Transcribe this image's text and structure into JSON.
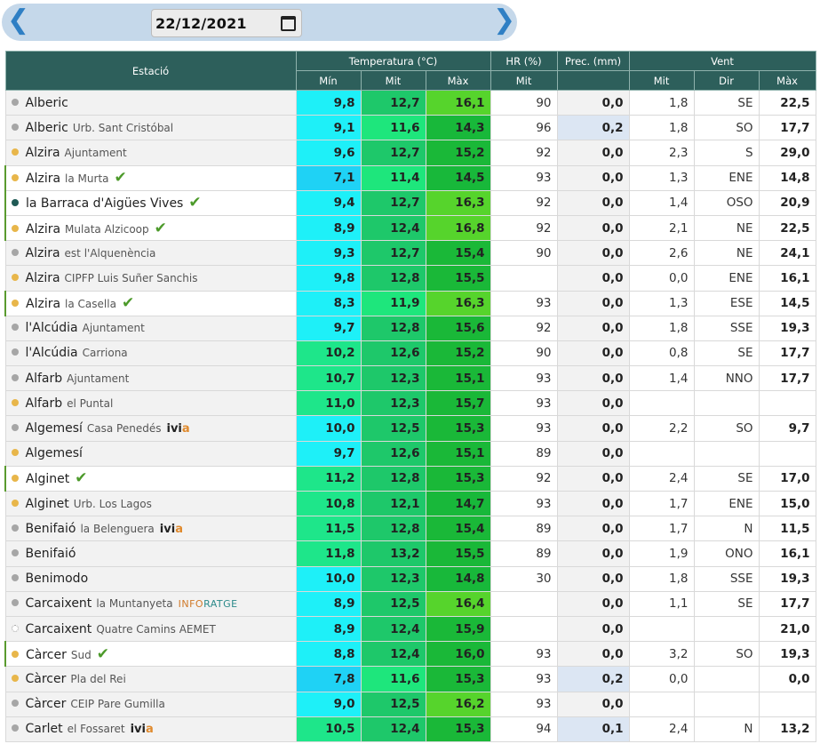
{
  "date_nav": {
    "prev_icon": "chevron-left-icon",
    "next_icon": "chevron-right-icon",
    "date_value": "22/12/2021",
    "calendar_icon": "calendar-icon"
  },
  "headers": {
    "station": "Estació",
    "temperature": "Temperatura (°C)",
    "hr": "HR (%)",
    "prec": "Prec. (mm)",
    "wind": "Vent",
    "t_min": "Mín",
    "t_mit": "Mit",
    "t_max": "Màx",
    "hr_mit": "Mit",
    "w_mit": "Mit",
    "w_dir": "Dir",
    "w_max": "Màx"
  },
  "colors": {
    "header_bg": "#2d5f5b",
    "dot_gray": "#a6a6a6",
    "dot_orange": "#e8b64a",
    "dot_teal": "#1f5a55",
    "check": "#4c9a2a",
    "prec_highlight": "#dce6f3"
  },
  "rows": [
    {
      "name": "Alberic",
      "loc": "",
      "dot": "gray",
      "hl": false,
      "check": false,
      "badge": "",
      "tmin": "9,8",
      "tmit": "12,7",
      "tmax": "16,1",
      "hr": "90",
      "prec": "0,0",
      "wmit": "1,8",
      "wdir": "SE",
      "wmax": "22,5",
      "cmin": "#1ef0f8",
      "cmit": "#1ec86a",
      "cmax": "#56d42c"
    },
    {
      "name": "Alberic",
      "loc": "Urb. Sant Cristóbal",
      "dot": "gray",
      "hl": false,
      "check": false,
      "badge": "",
      "tmin": "9,1",
      "tmit": "11,6",
      "tmax": "14,3",
      "hr": "96",
      "prec": "0,2",
      "wmit": "1,8",
      "wdir": "SO",
      "wmax": "17,7",
      "cmin": "#1ef0f8",
      "cmit": "#1ee67c",
      "cmax": "#18b83a"
    },
    {
      "name": "Alzira",
      "loc": "Ajuntament",
      "dot": "orange",
      "hl": false,
      "check": false,
      "badge": "",
      "tmin": "9,6",
      "tmit": "12,7",
      "tmax": "15,2",
      "hr": "92",
      "prec": "0,0",
      "wmit": "2,3",
      "wdir": "S",
      "wmax": "29,0",
      "cmin": "#1ef0f8",
      "cmit": "#1ec86a",
      "cmax": "#1ab838"
    },
    {
      "name": "Alzira",
      "loc": "la Murta",
      "dot": "orange",
      "hl": true,
      "check": true,
      "badge": "",
      "tmin": "7,1",
      "tmit": "11,4",
      "tmax": "14,5",
      "hr": "93",
      "prec": "0,0",
      "wmit": "1,3",
      "wdir": "ENE",
      "wmax": "14,8",
      "cmin": "#1fd2f5",
      "cmit": "#1ee67c",
      "cmax": "#18b83a"
    },
    {
      "name": "la Barraca d'Aigües Vives",
      "loc": "",
      "dot": "teal",
      "hl": true,
      "check": true,
      "badge": "",
      "tmin": "9,4",
      "tmit": "12,7",
      "tmax": "16,3",
      "hr": "92",
      "prec": "0,0",
      "wmit": "1,4",
      "wdir": "OSO",
      "wmax": "20,9",
      "cmin": "#1ef0f8",
      "cmit": "#1ec86a",
      "cmax": "#56d42c"
    },
    {
      "name": "Alzira",
      "loc": "Mulata Alzicoop",
      "dot": "orange",
      "hl": true,
      "check": true,
      "badge": "",
      "tmin": "8,9",
      "tmit": "12,4",
      "tmax": "16,8",
      "hr": "92",
      "prec": "0,0",
      "wmit": "2,1",
      "wdir": "NE",
      "wmax": "22,5",
      "cmin": "#1ef0f8",
      "cmit": "#1ec86a",
      "cmax": "#56d42c"
    },
    {
      "name": "Alzira",
      "loc": "est l'Alquenència",
      "dot": "gray",
      "hl": false,
      "check": false,
      "badge": "",
      "tmin": "9,3",
      "tmit": "12,7",
      "tmax": "15,4",
      "hr": "90",
      "prec": "0,0",
      "wmit": "2,6",
      "wdir": "NE",
      "wmax": "24,1",
      "cmin": "#1ef0f8",
      "cmit": "#1ec86a",
      "cmax": "#1ab838"
    },
    {
      "name": "Alzira",
      "loc": "CIPFP Luis Suñer Sanchis",
      "dot": "orange",
      "hl": false,
      "check": false,
      "badge": "",
      "tmin": "9,8",
      "tmit": "12,8",
      "tmax": "15,5",
      "hr": "",
      "prec": "0,0",
      "wmit": "0,0",
      "wdir": "ENE",
      "wmax": "16,1",
      "cmin": "#1ef0f8",
      "cmit": "#1ec86a",
      "cmax": "#1ab838"
    },
    {
      "name": "Alzira",
      "loc": "la Casella",
      "dot": "orange",
      "hl": true,
      "check": true,
      "badge": "",
      "tmin": "8,3",
      "tmit": "11,9",
      "tmax": "16,3",
      "hr": "93",
      "prec": "0,0",
      "wmit": "1,3",
      "wdir": "ESE",
      "wmax": "14,5",
      "cmin": "#1ef0f8",
      "cmit": "#1ee67c",
      "cmax": "#56d42c"
    },
    {
      "name": "l'Alcúdia",
      "loc": "Ajuntament",
      "dot": "gray",
      "hl": false,
      "check": false,
      "badge": "",
      "tmin": "9,7",
      "tmit": "12,8",
      "tmax": "15,6",
      "hr": "92",
      "prec": "0,0",
      "wmit": "1,8",
      "wdir": "SSE",
      "wmax": "19,3",
      "cmin": "#1ef0f8",
      "cmit": "#1ec86a",
      "cmax": "#1ab838"
    },
    {
      "name": "l'Alcúdia",
      "loc": "Carriona",
      "dot": "gray",
      "hl": false,
      "check": false,
      "badge": "",
      "tmin": "10,2",
      "tmit": "12,6",
      "tmax": "15,2",
      "hr": "90",
      "prec": "0,0",
      "wmit": "0,8",
      "wdir": "SE",
      "wmax": "17,7",
      "cmin": "#1ee68a",
      "cmit": "#1ec86a",
      "cmax": "#1ab838"
    },
    {
      "name": "Alfarb",
      "loc": "Ajuntament",
      "dot": "gray",
      "hl": false,
      "check": false,
      "badge": "",
      "tmin": "10,7",
      "tmit": "12,3",
      "tmax": "15,1",
      "hr": "93",
      "prec": "0,0",
      "wmit": "1,4",
      "wdir": "NNO",
      "wmax": "17,7",
      "cmin": "#1ee68a",
      "cmit": "#1ec86a",
      "cmax": "#1ab838"
    },
    {
      "name": "Alfarb",
      "loc": "el Puntal",
      "dot": "orange",
      "hl": false,
      "check": false,
      "badge": "",
      "tmin": "11,0",
      "tmit": "12,3",
      "tmax": "15,7",
      "hr": "93",
      "prec": "0,0",
      "wmit": "",
      "wdir": "",
      "wmax": "",
      "cmin": "#1ee68a",
      "cmit": "#1ec86a",
      "cmax": "#1ab838"
    },
    {
      "name": "Algemesí",
      "loc": "Casa Penedés",
      "dot": "gray",
      "hl": false,
      "check": false,
      "badge": "ivia",
      "tmin": "10,0",
      "tmit": "12,5",
      "tmax": "15,3",
      "hr": "93",
      "prec": "0,0",
      "wmit": "2,2",
      "wdir": "SO",
      "wmax": "9,7",
      "cmin": "#1ef0f8",
      "cmit": "#1ec86a",
      "cmax": "#1ab838"
    },
    {
      "name": "Algemesí",
      "loc": "",
      "dot": "orange",
      "hl": false,
      "check": false,
      "badge": "",
      "tmin": "9,7",
      "tmit": "12,6",
      "tmax": "15,1",
      "hr": "89",
      "prec": "0,0",
      "wmit": "",
      "wdir": "",
      "wmax": "",
      "cmin": "#1ef0f8",
      "cmit": "#1ec86a",
      "cmax": "#1ab838"
    },
    {
      "name": "Alginet",
      "loc": "",
      "dot": "orange",
      "hl": true,
      "check": true,
      "badge": "",
      "tmin": "11,2",
      "tmit": "12,8",
      "tmax": "15,3",
      "hr": "92",
      "prec": "0,0",
      "wmit": "2,4",
      "wdir": "SE",
      "wmax": "17,0",
      "cmin": "#1ee68a",
      "cmit": "#1ec86a",
      "cmax": "#1ab838"
    },
    {
      "name": "Alginet",
      "loc": "Urb. Los Lagos",
      "dot": "orange",
      "hl": false,
      "check": false,
      "badge": "",
      "tmin": "10,8",
      "tmit": "12,1",
      "tmax": "14,7",
      "hr": "93",
      "prec": "0,0",
      "wmit": "1,7",
      "wdir": "ENE",
      "wmax": "15,0",
      "cmin": "#1ee68a",
      "cmit": "#1ec86a",
      "cmax": "#18b83a"
    },
    {
      "name": "Benifaió",
      "loc": "la Belenguera",
      "dot": "gray",
      "hl": false,
      "check": false,
      "badge": "ivia",
      "tmin": "11,5",
      "tmit": "12,8",
      "tmax": "15,4",
      "hr": "89",
      "prec": "0,0",
      "wmit": "1,7",
      "wdir": "N",
      "wmax": "11,5",
      "cmin": "#1ee68a",
      "cmit": "#1ec86a",
      "cmax": "#1ab838"
    },
    {
      "name": "Benifaió",
      "loc": "",
      "dot": "gray",
      "hl": false,
      "check": false,
      "badge": "",
      "tmin": "11,8",
      "tmit": "13,2",
      "tmax": "15,5",
      "hr": "89",
      "prec": "0,0",
      "wmit": "1,9",
      "wdir": "ONO",
      "wmax": "16,1",
      "cmin": "#1ee68a",
      "cmit": "#1ec86a",
      "cmax": "#1ab838"
    },
    {
      "name": "Benimodo",
      "loc": "",
      "dot": "gray",
      "hl": false,
      "check": false,
      "badge": "",
      "tmin": "10,0",
      "tmit": "12,3",
      "tmax": "14,8",
      "hr": "30",
      "prec": "0,0",
      "wmit": "1,8",
      "wdir": "SSE",
      "wmax": "19,3",
      "cmin": "#1ef0f8",
      "cmit": "#1ec86a",
      "cmax": "#18b83a"
    },
    {
      "name": "Carcaixent",
      "loc": "la Muntanyeta",
      "dot": "gray",
      "hl": false,
      "check": false,
      "badge": "inforatge",
      "tmin": "8,9",
      "tmit": "12,5",
      "tmax": "16,4",
      "hr": "",
      "prec": "0,0",
      "wmit": "1,1",
      "wdir": "SE",
      "wmax": "17,7",
      "cmin": "#1ef0f8",
      "cmit": "#1ec86a",
      "cmax": "#56d42c"
    },
    {
      "name": "Carcaixent",
      "loc": "Quatre Camins AEMET",
      "dot": "empty",
      "hl": false,
      "check": false,
      "badge": "",
      "tmin": "8,9",
      "tmit": "12,4",
      "tmax": "15,9",
      "hr": "",
      "prec": "0,0",
      "wmit": "",
      "wdir": "",
      "wmax": "21,0",
      "cmin": "#1ef0f8",
      "cmit": "#1ec86a",
      "cmax": "#1ab838"
    },
    {
      "name": "Càrcer",
      "loc": "Sud",
      "dot": "orange",
      "hl": true,
      "check": true,
      "badge": "",
      "tmin": "8,8",
      "tmit": "12,4",
      "tmax": "16,0",
      "hr": "93",
      "prec": "0,0",
      "wmit": "3,2",
      "wdir": "SO",
      "wmax": "19,3",
      "cmin": "#1ef0f8",
      "cmit": "#1ec86a",
      "cmax": "#1ab838"
    },
    {
      "name": "Càrcer",
      "loc": "Pla del Rei",
      "dot": "orange",
      "hl": false,
      "check": false,
      "badge": "",
      "tmin": "7,8",
      "tmit": "11,6",
      "tmax": "15,3",
      "hr": "93",
      "prec": "0,2",
      "wmit": "0,0",
      "wdir": "",
      "wmax": "0,0",
      "cmin": "#1fd2f5",
      "cmit": "#1ee67c",
      "cmax": "#1ab838"
    },
    {
      "name": "Càrcer",
      "loc": "CEIP Pare Gumilla",
      "dot": "gray",
      "hl": false,
      "check": false,
      "badge": "",
      "tmin": "9,0",
      "tmit": "12,5",
      "tmax": "16,2",
      "hr": "93",
      "prec": "0,0",
      "wmit": "",
      "wdir": "",
      "wmax": "",
      "cmin": "#1ef0f8",
      "cmit": "#1ec86a",
      "cmax": "#56d42c"
    },
    {
      "name": "Carlet",
      "loc": "el Fossaret",
      "dot": "gray",
      "hl": false,
      "check": false,
      "badge": "ivia",
      "tmin": "10,5",
      "tmit": "12,4",
      "tmax": "15,3",
      "hr": "94",
      "prec": "0,1",
      "wmit": "2,4",
      "wdir": "N",
      "wmax": "13,2",
      "cmin": "#1ee68a",
      "cmit": "#1ec86a",
      "cmax": "#1ab838"
    }
  ]
}
